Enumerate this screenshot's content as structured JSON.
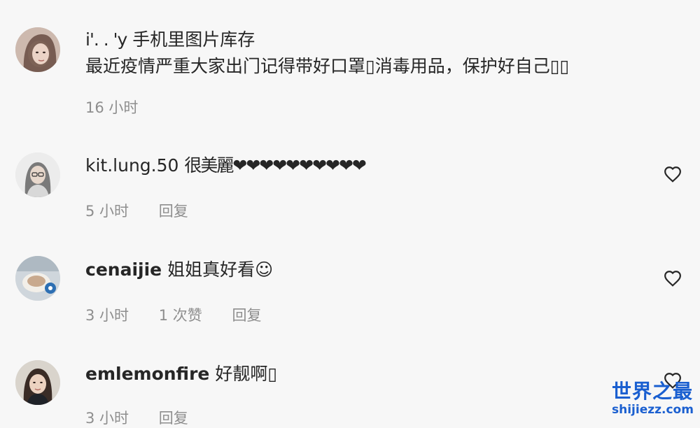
{
  "comments": [
    {
      "username": "i'. . 'y",
      "text": "手机里图片库存",
      "body": "最近疫情严重大家出门记得带好口罩▯消毒用品，保护好自己▯▯",
      "time": "16 小时",
      "likes": "",
      "reply": ""
    },
    {
      "username": "kit.lung.50",
      "text": "很美麗❤❤❤❤❤❤❤❤❤❤",
      "time": "5 小时",
      "likes": "",
      "reply": "回复"
    },
    {
      "username": "cenaijie",
      "text": "姐姐真好看☺",
      "time": "3 小时",
      "likes": "1 次赞",
      "reply": "回复"
    },
    {
      "username": "emlemonfire",
      "text": "好靓啊▯",
      "time": "3 小时",
      "likes": "",
      "reply": "回复"
    }
  ],
  "icons": {
    "like": "heart-outline-icon"
  },
  "watermark": {
    "title": "世界之最",
    "url": "shijiezz.com"
  },
  "colors": {
    "background": "#f7f7f7",
    "text": "#262626",
    "meta": "#8e8e8e",
    "watermark": "#1a5fd0"
  }
}
